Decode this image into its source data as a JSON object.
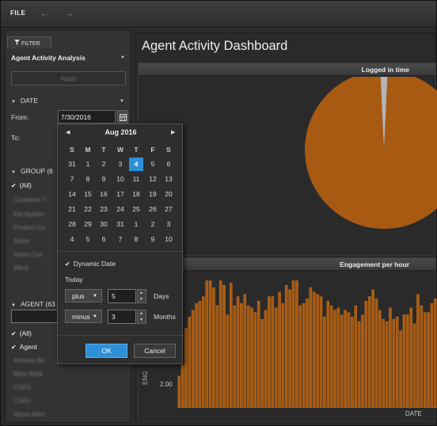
{
  "toolbar": {
    "file_label": "FILE",
    "back_icon": "back-arrow-icon",
    "forward_icon": "forward-arrow-icon"
  },
  "filter": {
    "tab_label": "FILTER",
    "analysis_name": "Agent Activity Analysis",
    "apply_label": "Apply",
    "date": {
      "header": "DATE",
      "from_label": "From:",
      "from_value": "7/30/2016",
      "to_label": "To:"
    },
    "group": {
      "header": "GROUP (6",
      "all_label": "(All)",
      "items": [
        "Customer T",
        "Kel Applies",
        "Product Ge",
        "Sales",
        "Sales Coo",
        "Wkrd"
      ]
    },
    "agent": {
      "header": "AGENT (63",
      "all_label": "(All)",
      "agent_label": "Agent",
      "items": [
        "Andrew Ba",
        "Mike Walk",
        "CSR3",
        "CSR2",
        "Steve Allen"
      ]
    }
  },
  "calendar": {
    "month_title": "Aug  2016",
    "weekdays": [
      "S",
      "M",
      "T",
      "W",
      "T",
      "F",
      "S"
    ],
    "weeks": [
      [
        "31",
        "1",
        "2",
        "3",
        "4",
        "5",
        "6"
      ],
      [
        "7",
        "8",
        "9",
        "10",
        "11",
        "12",
        "13"
      ],
      [
        "14",
        "15",
        "16",
        "17",
        "18",
        "19",
        "20"
      ],
      [
        "21",
        "22",
        "23",
        "24",
        "25",
        "26",
        "27"
      ],
      [
        "28",
        "29",
        "30",
        "31",
        "1",
        "2",
        "3"
      ],
      [
        "4",
        "5",
        "6",
        "7",
        "8",
        "9",
        "10"
      ]
    ],
    "selected_day": "4",
    "dynamic_date_label": "Dynamic Date",
    "today_label": "Today",
    "row1": {
      "op": "plus",
      "value": "5",
      "unit": "Days"
    },
    "row2": {
      "op": "minus",
      "value": "3",
      "unit": "Months"
    },
    "ok_label": "OK",
    "cancel_label": "Cancel",
    "selected_color": "#2e8fd6"
  },
  "dashboard": {
    "title": "Agent Activity Dashboard",
    "panel1_title": "Logged in time",
    "panel2_title": "Engagement per hour"
  },
  "chart_data": [
    {
      "type": "pie",
      "title": "Logged in time",
      "slices": [
        {
          "value": 98.5,
          "color": "#a85a12"
        },
        {
          "value": 1.5,
          "color": "#b5b5b5"
        }
      ]
    },
    {
      "type": "bar",
      "title": "Engagement per hour",
      "xlabel": "DATE",
      "ylabel": "ENG",
      "y_ticks": [
        "2.00"
      ],
      "bar_color": "#a85a12",
      "values": [
        1.4,
        1.9,
        3.5,
        4.0,
        4.3,
        4.6,
        4.7,
        4.9,
        5.6,
        5.6,
        5.3,
        4.5,
        5.6,
        5.4,
        4.1,
        5.5,
        4.5,
        4.9,
        4.6,
        5.0,
        4.5,
        4.4,
        4.2,
        4.7,
        3.9,
        4.3,
        4.9,
        4.9,
        4.4,
        5.1,
        4.6,
        5.4,
        5.2,
        5.6,
        5.6,
        4.5,
        4.6,
        4.8,
        5.3,
        5.1,
        5.0,
        4.9,
        4.0,
        4.7,
        4.5,
        4.3,
        4.4,
        4.1,
        4.3,
        4.2,
        4.0,
        4.5,
        3.8,
        4.1,
        4.7,
        4.9,
        5.2,
        4.8,
        4.3,
        3.9,
        3.8,
        4.4,
        3.9,
        4.0,
        3.4,
        4.1,
        4.1,
        4.4,
        3.7,
        5.0,
        4.5,
        4.2,
        4.2,
        4.6,
        4.8
      ]
    }
  ]
}
